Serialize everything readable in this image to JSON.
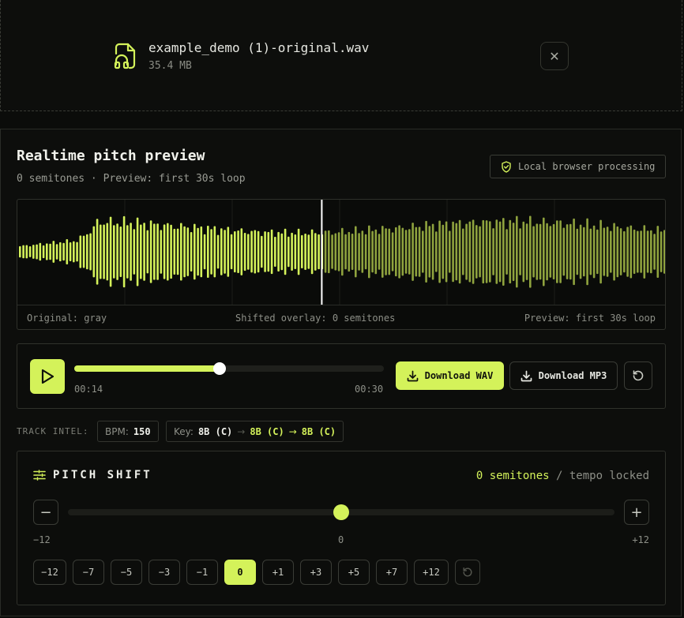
{
  "file": {
    "name": "example_demo (1)-original.wav",
    "size": "35.4 MB",
    "close_icon": "close-icon"
  },
  "preview": {
    "title": "Realtime pitch preview",
    "subtitle": "0 semitones · Preview: first 30s loop",
    "local_badge": "Local browser processing"
  },
  "waveform": {
    "legend_original": "Original: gray",
    "legend_shifted": "Shifted overlay: 0 semitones",
    "legend_preview": "Preview: first 30s loop",
    "playhead_fraction": 0.47
  },
  "player": {
    "current_time": "00:14",
    "duration": "00:30",
    "progress": 0.47,
    "download_wav": "Download WAV",
    "download_mp3": "Download MP3"
  },
  "track_intel": {
    "label": "TRACK INTEL:",
    "bpm_label": "BPM:",
    "bpm_value": "150",
    "key_label": "Key:",
    "key_original": "8B (C)",
    "key_sep": "→",
    "key_mid": "8B (C)",
    "key_arrow": "→",
    "key_shifted": "8B (C)"
  },
  "pitch": {
    "title": "PITCH SHIFT",
    "status_value": "0 semitones",
    "status_rest": " / tempo locked",
    "min_label": "−12",
    "mid_label": "0",
    "max_label": "+12",
    "minus_label": "−",
    "plus_label": "+",
    "value": 0,
    "min": -12,
    "max": 12,
    "presets": [
      "−12",
      "−7",
      "−5",
      "−3",
      "−1",
      "0",
      "+1",
      "+3",
      "+5",
      "+7",
      "+12"
    ],
    "active_preset": "0"
  },
  "colors": {
    "accent": "#d4f25a"
  }
}
